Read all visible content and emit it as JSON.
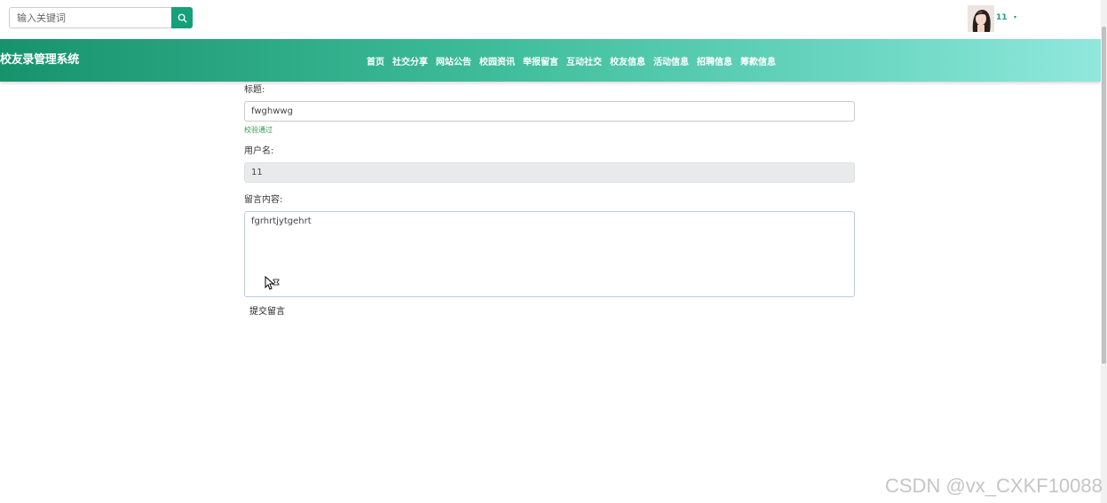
{
  "header": {
    "search_placeholder": "输入关键词",
    "user_name": "11",
    "user_caret": "▾"
  },
  "nav": {
    "site_title": "校友录管理系统",
    "items": [
      "首页",
      "社交分享",
      "网站公告",
      "校园资讯",
      "举报留言",
      "互动社交",
      "校友信息",
      "活动信息",
      "招聘信息",
      "筹款信息"
    ]
  },
  "form": {
    "title_label": "标题:",
    "title_value": "fwghwwg",
    "title_valid": "校验通过",
    "username_label": "用户名:",
    "username_value": "11",
    "content_label": "留言内容:",
    "content_value": "fgrhrtjytgehrt",
    "submit_label": "提交留言"
  },
  "watermark": "CSDN @vx_CXKF10088",
  "colors": {
    "accent": "#15a07a",
    "nav_start": "#17936c",
    "nav_end": "#90e8dc",
    "valid": "#2b9a4a"
  },
  "icons": {
    "search": "search-icon",
    "avatar": "avatar",
    "cursor": "cursor-icon"
  }
}
